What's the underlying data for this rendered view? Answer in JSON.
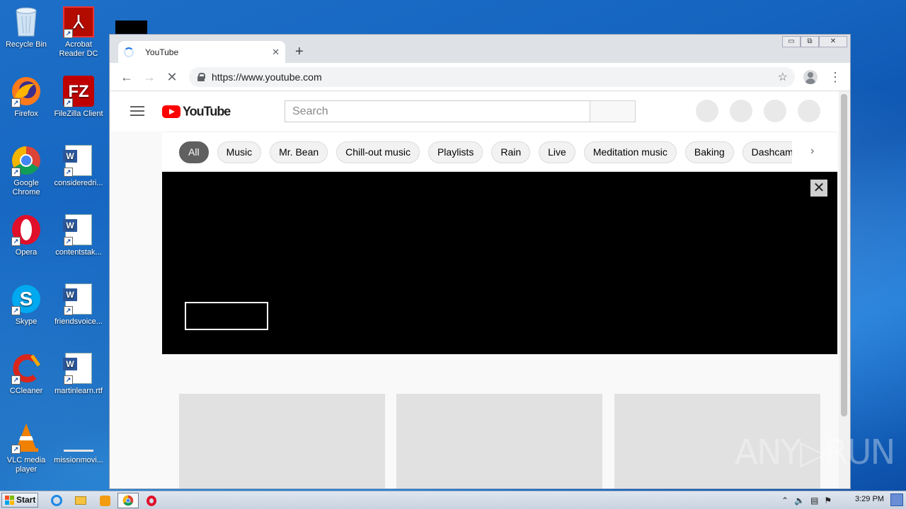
{
  "desktop": {
    "icons": [
      {
        "label": "Recycle Bin",
        "icon": "recycle-bin-icon"
      },
      {
        "label": "Acrobat Reader DC",
        "icon": "acrobat-icon"
      },
      {
        "label": "Firefox",
        "icon": "firefox-icon"
      },
      {
        "label": "FileZilla Client",
        "icon": "filezilla-icon"
      },
      {
        "label": "Google Chrome",
        "icon": "chrome-icon"
      },
      {
        "label": "consideredri...",
        "icon": "word-doc-icon"
      },
      {
        "label": "Opera",
        "icon": "opera-icon"
      },
      {
        "label": "contentstak...",
        "icon": "word-doc-icon"
      },
      {
        "label": "Skype",
        "icon": "skype-icon"
      },
      {
        "label": "friendsvoice...",
        "icon": "word-doc-icon"
      },
      {
        "label": "CCleaner",
        "icon": "ccleaner-icon"
      },
      {
        "label": "martinlearn.rtf",
        "icon": "word-doc-icon"
      },
      {
        "label": "VLC media player",
        "icon": "vlc-icon"
      },
      {
        "label": "missionmovi...",
        "icon": "blank-file-icon"
      }
    ]
  },
  "browser": {
    "tab_title": "YouTube",
    "tab_close": "✕",
    "new_tab": "+",
    "back": "←",
    "forward": "→",
    "stop": "✕",
    "url": "https://www.youtube.com",
    "star": "☆",
    "menu": "⋮",
    "window_controls": {
      "minimize": "▭",
      "restore": "⧉",
      "close": "✕"
    }
  },
  "youtube": {
    "logo_text": "YouTube",
    "search_placeholder": "Search",
    "chips": [
      "All",
      "Music",
      "Mr. Bean",
      "Chill-out music",
      "Playlists",
      "Rain",
      "Live",
      "Meditation music",
      "Baking",
      "Dashcam"
    ],
    "active_chip": "All",
    "chip_next": "›",
    "player_close": "✕"
  },
  "watermark": "ANY▷RUN",
  "taskbar": {
    "start_label": "Start",
    "clock": "3:29 PM",
    "tray_arrow": "⌃"
  }
}
